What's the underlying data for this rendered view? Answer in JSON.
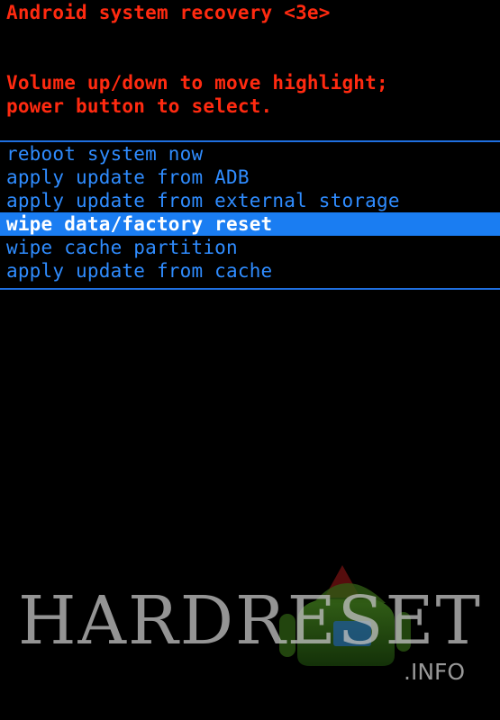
{
  "header": {
    "title": "Android system recovery <3e>"
  },
  "instructions": {
    "line1": "Volume up/down to move highlight;",
    "line2": "power button to select."
  },
  "menu": {
    "items": [
      {
        "label": "reboot system now",
        "selected": false
      },
      {
        "label": "apply update from ADB",
        "selected": false
      },
      {
        "label": "apply update from external storage",
        "selected": false
      },
      {
        "label": "wipe data/factory reset",
        "selected": true
      },
      {
        "label": "wipe cache partition",
        "selected": false
      },
      {
        "label": "apply update from cache",
        "selected": false
      }
    ]
  },
  "watermark": {
    "brand": "HARDRESET",
    "suffix": ".INFO"
  },
  "colors": {
    "background": "#000000",
    "header_text": "#ff2a10",
    "menu_text": "#2f8cff",
    "selection_bg": "#1a7df2",
    "selection_text": "#ffffff"
  },
  "icons": {
    "robot": "android-robot-icon"
  }
}
